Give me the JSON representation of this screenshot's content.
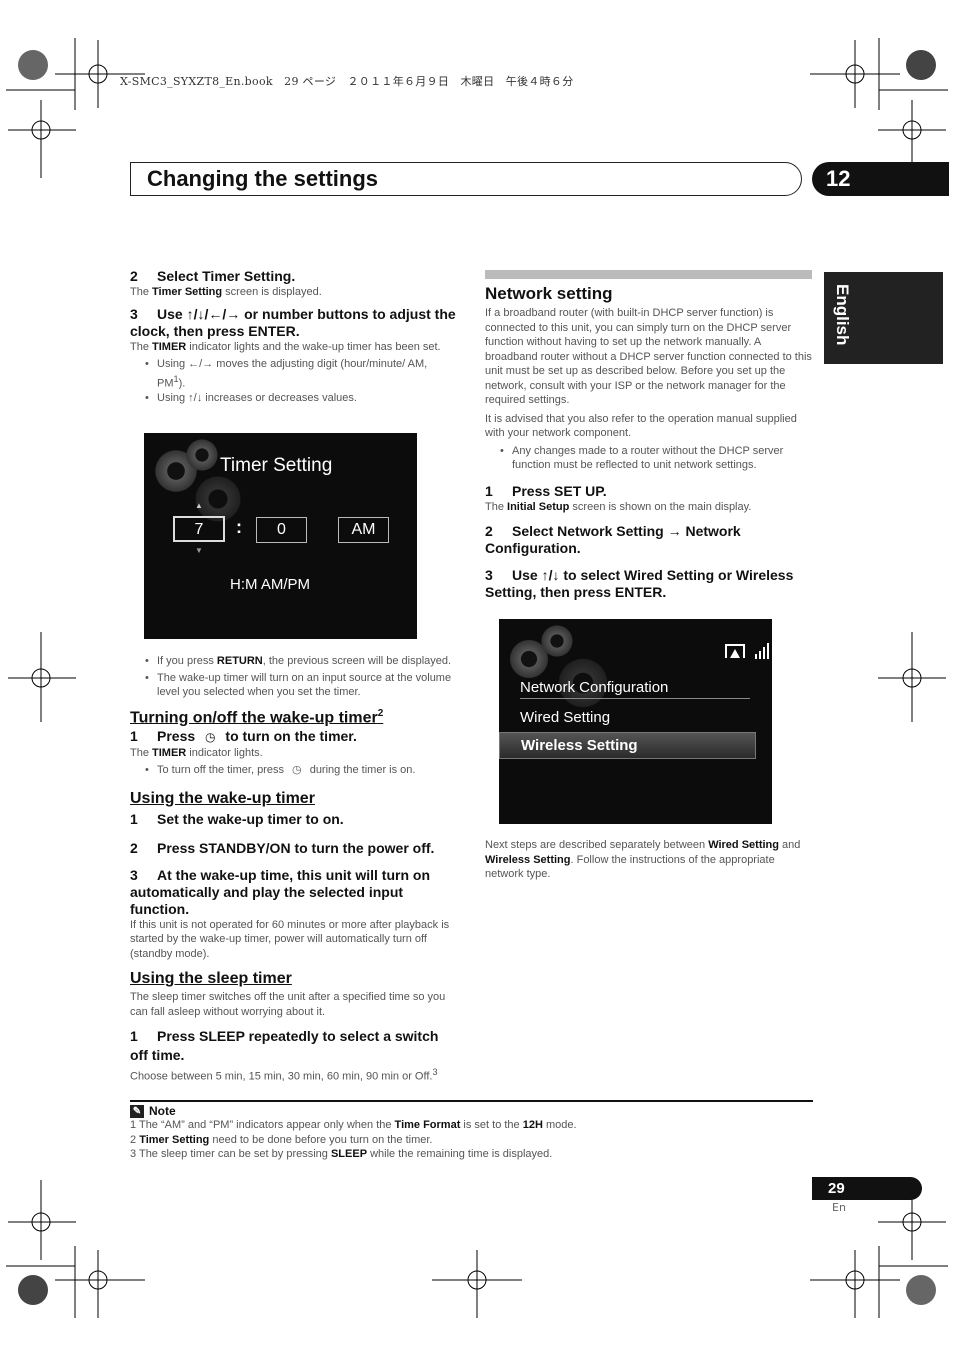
{
  "book_header": "X-SMC3_SYXZT8_En.book　29 ページ　２０１１年６月９日　木曜日　午後４時６分",
  "header": {
    "title": "Changing the settings",
    "chapter": "12",
    "language": "English"
  },
  "left": {
    "s2": {
      "n": "2",
      "t": "Select Timer Setting."
    },
    "s2p": [
      "The ",
      "Timer Setting",
      " screen is displayed."
    ],
    "s3": {
      "n": "3",
      "t": "Use ↑/↓/←/→ or number buttons to adjust the clock, then press ENTER."
    },
    "s3p": [
      "The ",
      "TIMER",
      " indicator lights and the wake-up timer has been set."
    ],
    "b1": "Using ←/→ moves the adjusting digit (hour/minute/ AM, PM",
    "b1sup": "1",
    "b1end": ").",
    "b2": "Using ↑/↓ increases or decreases values.",
    "timer_screen": {
      "title": "Timer Setting",
      "hour": "7",
      "sep": ":",
      "minute": "0",
      "ampm": "AM",
      "format": "H:M AM/PM",
      "up": "▲",
      "down": "▼"
    },
    "b3": [
      "If you press ",
      "RETURN",
      ", the previous screen will be displayed."
    ],
    "b4": "The wake-up timer will turn on an input source at the volume level you selected when you set the timer.",
    "h1": "Turning on/off the wake-up timer",
    "h1sup": "2",
    "t1": {
      "n": "1",
      "a": "Press ",
      "b": " to turn on the timer."
    },
    "t1p": [
      "The ",
      "TIMER",
      " indicator lights."
    ],
    "b5a": "To turn off the timer, press ",
    "b5b": " during the timer is on.",
    "h2": "Using the wake-up timer",
    "u1": {
      "n": "1",
      "t": "Set the wake-up timer to on."
    },
    "u2": {
      "n": "2",
      "t": "Press STANDBY/ON to turn the power off."
    },
    "u3": {
      "n": "3",
      "t": "At the wake-up time, this unit will turn on automatically and play the selected input function."
    },
    "u3p": "If this unit is not operated for 60 minutes or more after playback is started by the wake-up timer, power will automatically turn off (standby mode).",
    "h3": "Using the sleep timer",
    "h3p": "The sleep timer switches off the unit after a specified time so you can fall asleep without worrying about it.",
    "sl1": {
      "n": "1",
      "t": "Press SLEEP repeatedly to select a switch off time."
    },
    "sl1p": "Choose between 5 min, 15 min, 30 min, 60 min, 90 min or Off.",
    "sl1sup": "3"
  },
  "right": {
    "title": "Network setting",
    "p1": "If a broadband router (with built-in DHCP server function) is connected to this unit, you can simply turn on the DHCP server function without having to set up the network manually. A broadband router without a DHCP server function connected to this unit must be set up as described below. Before you set up the network, consult with your ISP or the network manager for the required settings.",
    "p2": "It is advised that you also refer to the operation manual supplied with your network component.",
    "b1": "Any changes made to a router without the DHCP server function must be reflected to unit network settings.",
    "s1": {
      "n": "1",
      "t": "Press SET UP."
    },
    "s1p": [
      "The ",
      "Initial Setup",
      " screen is shown on the main display."
    ],
    "s2": {
      "n": "2",
      "t": "Select Network Setting → Network Configuration."
    },
    "s3": {
      "n": "3",
      "t": "Use ↑/↓ to select Wired Setting or Wireless Setting, then press ENTER."
    },
    "screen": {
      "heading": "Network Configuration",
      "items": [
        "Wired Setting",
        "Wireless Setting"
      ],
      "selected": "Wireless Setting"
    },
    "p3": [
      "Next steps are described separately between ",
      "Wired Setting",
      " and ",
      "Wireless Setting",
      ". Follow the instructions of the appropriate network type."
    ]
  },
  "notes": {
    "label": "Note",
    "items": [
      [
        "1 The “AM” and “PM” indicators appear only when the ",
        "Time Format",
        " is set to the ",
        "12H",
        " mode."
      ],
      [
        "2 ",
        "Timer Setting",
        " need to be done before you turn on the timer."
      ],
      [
        "3 The sleep timer can be set by pressing ",
        "SLEEP",
        " while the remaining time is displayed."
      ]
    ]
  },
  "footer": {
    "page": "29",
    "lang": "En"
  }
}
